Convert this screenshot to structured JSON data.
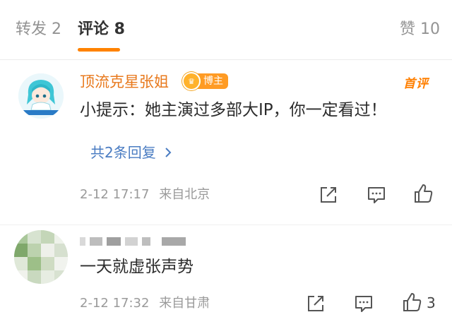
{
  "tabs": {
    "repost": "转发 2",
    "comments": "评论 8",
    "likes": "赞 10"
  },
  "comments": [
    {
      "username": "顶流克星张姐",
      "badge": "博主",
      "tag": "首评",
      "text": "小提示：她主演过多部大IP，你一定看过！",
      "replies": "共2条回复",
      "date": "2-12 17:17",
      "location": "来自北京"
    },
    {
      "text": "一天就虚张声势",
      "date": "2-12 17:32",
      "location": "来自甘肃",
      "like_count": "3"
    }
  ],
  "colors": {
    "accent": "#ff8200",
    "username": "#e8791d",
    "link": "#4a7cc2"
  },
  "icons": [
    "share-icon",
    "comment-icon",
    "like-icon",
    "chevron-right-icon",
    "crown-icon"
  ]
}
